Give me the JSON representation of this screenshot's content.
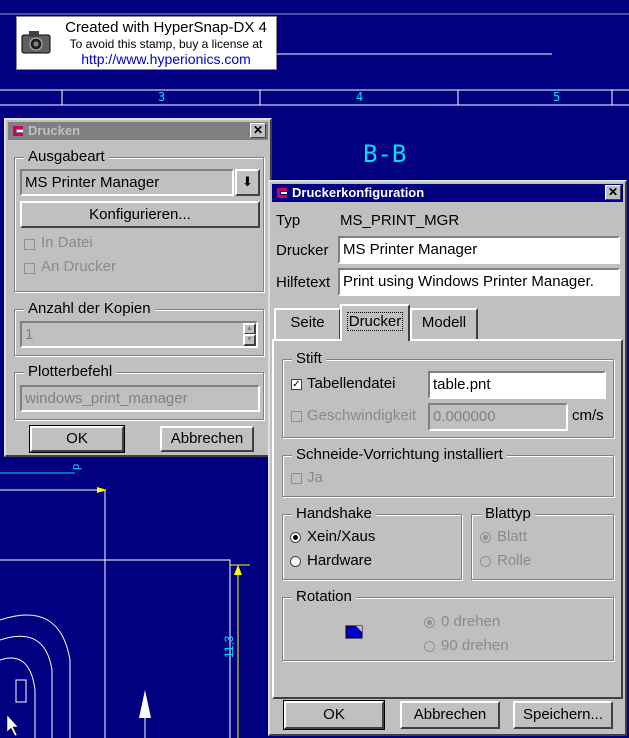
{
  "stamp": {
    "line1": "Created with HyperSnap-DX 4",
    "line2": "To avoid this stamp, buy a license at",
    "line3": "http://www.hyperionics.com"
  },
  "cad": {
    "ruler_numbers": [
      "3",
      "4",
      "5"
    ],
    "section_label": "B-B",
    "dim_vertical": "11,3",
    "dim_small": "p"
  },
  "drucken": {
    "title": "Drucken",
    "ausgabeart": {
      "label": "Ausgabeart",
      "selected": "MS Printer Manager",
      "configure_btn": "Konfigurieren...",
      "in_datei": "In Datei",
      "an_drucker": "An Drucker"
    },
    "kopien": {
      "label": "Anzahl der Kopien",
      "value": "1"
    },
    "plotter": {
      "label": "Plotterbefehl",
      "value": "windows_print_manager"
    },
    "ok": "OK",
    "cancel": "Abbrechen"
  },
  "konfig": {
    "title": "Druckerkonfiguration",
    "typ_label": "Typ",
    "typ_value": "MS_PRINT_MGR",
    "drucker_label": "Drucker",
    "drucker_value": "MS Printer Manager",
    "hilfetext_label": "Hilfetext",
    "hilfetext_value": "Print using Windows Printer Manager.",
    "tabs": [
      "Seite",
      "Drucker",
      "Modell"
    ],
    "active_tab": "Drucker",
    "stift": {
      "label": "Stift",
      "tabellendatei_label": "Tabellendatei",
      "tabellendatei_checked": true,
      "tabellendatei_value": "table.pnt",
      "geschw_label": "Geschwindigkeit",
      "geschw_value": "0.000000",
      "unit": "cm/s"
    },
    "schneide": {
      "label": "Schneide-Vorrichtung installiert",
      "ja": "Ja"
    },
    "handshake": {
      "label": "Handshake",
      "opt1": "Xein/Xaus",
      "opt2": "Hardware",
      "selected": "Xein/Xaus"
    },
    "blattyp": {
      "label": "Blattyp",
      "opt1": "Blatt",
      "opt2": "Rolle",
      "selected": "Blatt"
    },
    "rotation": {
      "label": "Rotation",
      "opt1": "0 drehen",
      "opt2": "90 drehen",
      "selected": "0 drehen"
    },
    "ok": "OK",
    "cancel": "Abbrechen",
    "save": "Speichern..."
  },
  "colors": {
    "background": "#000080",
    "titlebar_inactive": "#808080",
    "titlebar_active": "#000080",
    "cad_lines": "#ffffff",
    "cad_dims": "#00e0ff",
    "cad_accent": "#ffff00"
  }
}
